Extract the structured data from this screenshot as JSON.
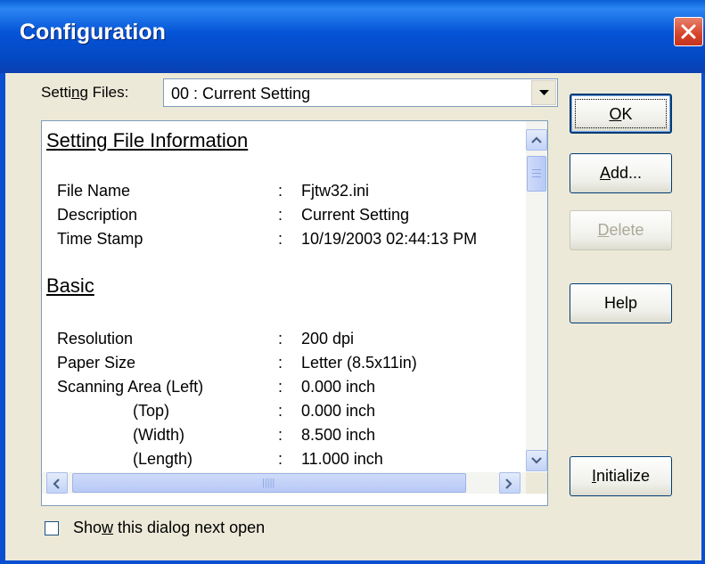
{
  "window": {
    "title": "Configuration"
  },
  "setting_files": {
    "label_pre": "Setti",
    "label_mn": "n",
    "label_post": "g Files:",
    "value": "00 : Current Setting"
  },
  "info": {
    "sections": [
      {
        "title": "Setting File Information",
        "rows": [
          {
            "label": "File Name",
            "value": "Fjtw32.ini"
          },
          {
            "label": "Description",
            "value": "Current Setting"
          },
          {
            "label": "Time Stamp",
            "value": "10/19/2003 02:44:13 PM"
          }
        ]
      },
      {
        "title": "Basic",
        "rows": [
          {
            "label": "Resolution",
            "value": "200 dpi"
          },
          {
            "label": "Paper Size",
            "value": "Letter (8.5x11in)"
          },
          {
            "label": "Scanning Area (Left)",
            "value": "0.000 inch"
          },
          {
            "label": "(Top)",
            "value": "0.000 inch"
          },
          {
            "label": "(Width)",
            "value": "8.500 inch"
          },
          {
            "label": "(Length)",
            "value": "11.000 inch"
          }
        ]
      }
    ],
    "separator": ":"
  },
  "buttons": {
    "ok": {
      "mn": "O",
      "rest": "K"
    },
    "add": {
      "mn": "A",
      "rest": "dd..."
    },
    "delete": {
      "mn": "D",
      "rest": "elete"
    },
    "help": {
      "label": "Help"
    },
    "initialize": {
      "mn": "I",
      "rest": "nitialize"
    }
  },
  "checkbox": {
    "pre": "Sho",
    "mn": "w",
    "post": " this dialog next open",
    "checked": false
  },
  "colors": {
    "title_bar": "#0553d6",
    "dialog_bg": "#ece9d8",
    "close": "#d5432a"
  },
  "icons": [
    "close-icon",
    "dropdown-arrow-icon",
    "scroll-up-icon",
    "scroll-down-icon",
    "scroll-left-icon",
    "scroll-right-icon"
  ]
}
